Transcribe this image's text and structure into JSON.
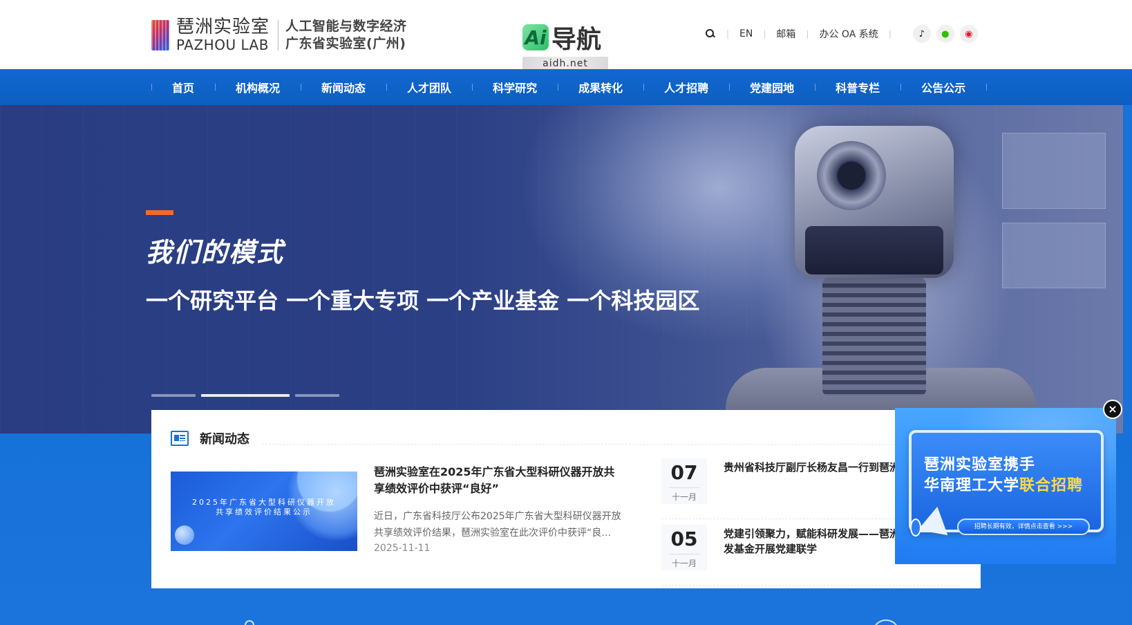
{
  "header": {
    "logo_cn": "琶洲实验室",
    "logo_en": "PAZHOU LAB",
    "logo_line1": "人工智能与数字经济",
    "logo_line2": "广东省实验室(广州)",
    "ai_badge_mark": "Ai",
    "ai_badge_title": "导航",
    "ai_badge_url": "aidh.net",
    "toolbar": {
      "search_icon": "search-icon",
      "lang": "EN",
      "mail": "邮箱",
      "oa": "办公 OA 系统"
    },
    "social": [
      {
        "name": "tiktok-icon",
        "glyph": "♪"
      },
      {
        "name": "wechat-icon",
        "glyph": "●"
      },
      {
        "name": "weibo-icon",
        "glyph": "◉"
      }
    ]
  },
  "nav": {
    "items": [
      "首页",
      "机构概况",
      "新闻动态",
      "人才团队",
      "科学研究",
      "成果转化",
      "人才招聘",
      "党建园地",
      "科普专栏",
      "公告公示"
    ]
  },
  "hero": {
    "title": "我们的模式",
    "subtitle": "一个研究平台 一个重大专项 一个产业基金 一个科技园区",
    "slides": 3,
    "active_slide": 2
  },
  "news": {
    "heading": "新闻动态",
    "feature": {
      "image_text_line1": "2025年广东省大型科研仪器开放",
      "image_text_line2": "共享绩效评价结果公示",
      "title": "琶洲实验室在2025年广东省大型科研仪器开放共享绩效评价中获评“良好”",
      "summary": "近日，广东省科技厅公布2025年广东省大型科研仪器开放共享绩效评价结果，琶洲实验室在此次评价中获评“良好”…",
      "date": "2025-11-11"
    },
    "list": [
      {
        "day": "07",
        "month": "十一月",
        "title": "贵州省科技厅副厅长杨友昌一行到琶洲实验室调研"
      },
      {
        "day": "05",
        "month": "十一月",
        "title": "党建引领聚力，赋能科研发展——琶洲实验室与广发基金开展党建联学"
      }
    ]
  },
  "popup": {
    "line1": "琶洲实验室携手",
    "line2_prefix": "华南理工大学",
    "line2_highlight": "联合招聘",
    "cta": "招聘长期有效，详情点击查看 >>>",
    "close": "×"
  },
  "colors": {
    "nav_blue": "#1168d0",
    "accent_orange": "#f26a2b",
    "highlight_yellow": "#ffd94a"
  }
}
